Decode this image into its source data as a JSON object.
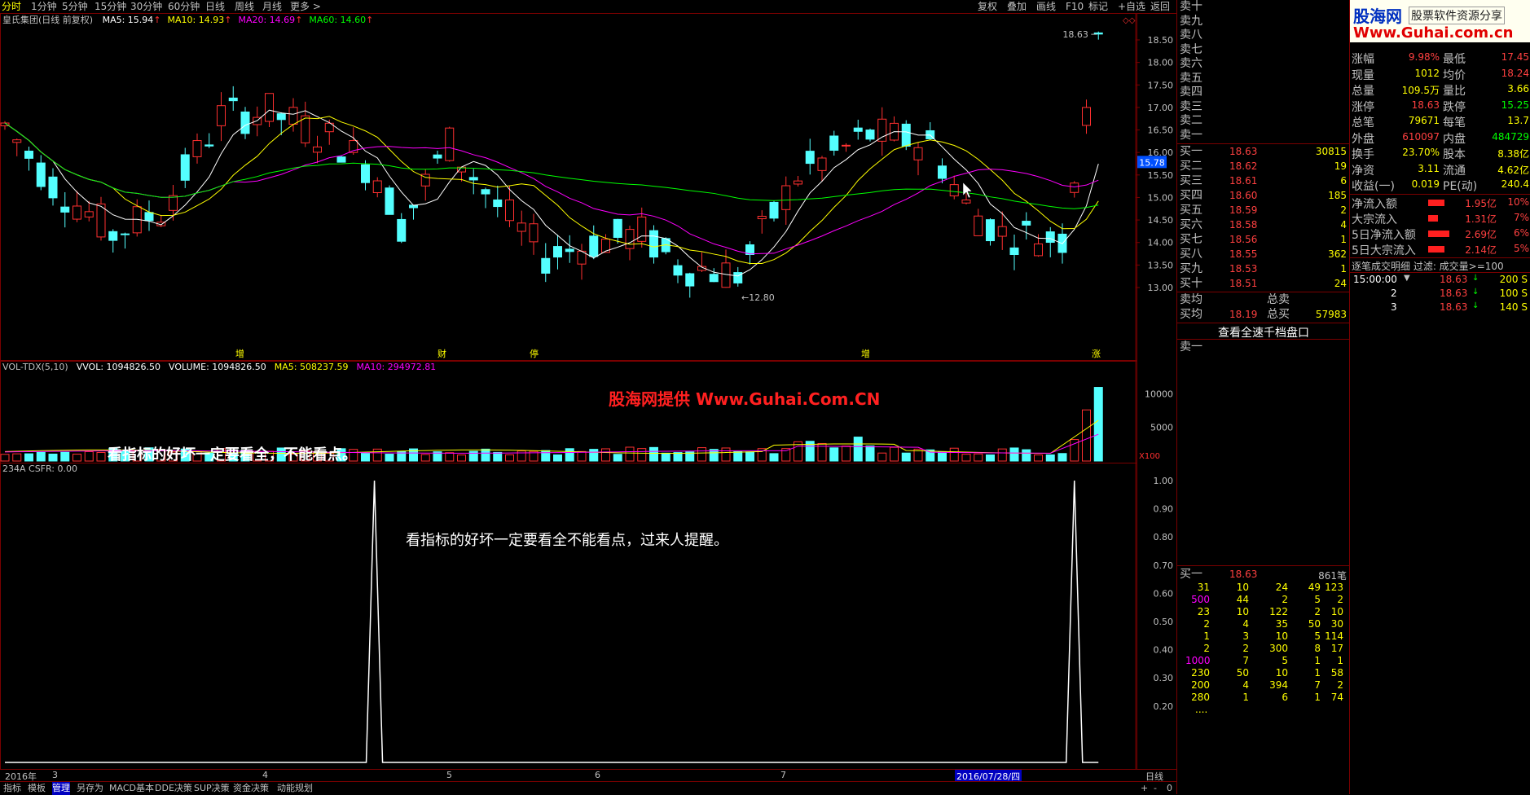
{
  "toolbar": {
    "periods": [
      "分时",
      "1分钟",
      "5分钟",
      "15分钟",
      "30分钟",
      "60分钟",
      "日线",
      "周线",
      "月线",
      "更多 >"
    ],
    "right_buttons": [
      "复权",
      "叠加",
      "画线",
      "F10",
      "标记",
      "+自选",
      "返回"
    ]
  },
  "main_chart": {
    "title": "皇氏集团(日线 前复权)",
    "ma_labels": [
      {
        "text": "MA5: 15.94",
        "color": "#ffffff"
      },
      {
        "text": "MA10: 14.93",
        "color": "#ffff00"
      },
      {
        "text": "MA20: 14.69",
        "color": "#ff00ff"
      },
      {
        "text": "MA60: 14.60",
        "color": "#00ff00"
      }
    ],
    "price_axis": [
      "18.50",
      "18.00",
      "17.50",
      "17.00",
      "16.50",
      "16.00",
      "15.50",
      "15.00",
      "14.50",
      "14.00",
      "13.50",
      "13.00"
    ],
    "current_price_tag": "15.78",
    "high_marker": "18.63",
    "low_marker": "12.80",
    "event_markers": [
      "增",
      "财",
      "停",
      "增",
      "涨"
    ]
  },
  "volume_chart": {
    "title_labels": [
      {
        "text": "VOL-TDX(5,10)",
        "color": "#c0c0c0"
      },
      {
        "text": "VVOL: 1094826.50",
        "color": "#ffffff"
      },
      {
        "text": "VOLUME: 1094826.50",
        "color": "#ffffff"
      },
      {
        "text": "MA5: 508237.59",
        "color": "#ffff00"
      },
      {
        "text": "MA10: 294972.81",
        "color": "#ff00ff"
      }
    ],
    "axis": [
      "10000",
      "5000"
    ],
    "multiplier": "X100",
    "watermark": "股海网提供 Www.Guhai.Com.CN",
    "annotation": "看指标的好坏一定要看全，不能看点。"
  },
  "indicator_chart": {
    "title": "234A  CSFR: 0.00",
    "axis": [
      "1.00",
      "0.90",
      "0.80",
      "0.70",
      "0.60",
      "0.50",
      "0.40",
      "0.30",
      "0.20"
    ],
    "annotation": "看指标的好坏一定要看全不能看点，过来人提醒。"
  },
  "date_axis": {
    "labels": [
      "2016年",
      "3",
      "4",
      "5",
      "6",
      "7"
    ],
    "highlight": "2016/07/28/四",
    "period": "日线"
  },
  "bottom_tabs": [
    "指标",
    "模板",
    "管理",
    "另存为",
    "MACD基本",
    "DDE决策",
    "SUP决策",
    "资金决策",
    "动能规划"
  ],
  "bottom_right": [
    "+",
    "-",
    "0"
  ],
  "order_book": {
    "sell_labels": [
      "卖十",
      "卖九",
      "卖八",
      "卖七",
      "卖六",
      "卖五",
      "卖四",
      "卖三",
      "卖二",
      "卖一"
    ],
    "buy_labels": [
      "买一",
      "买二",
      "买三",
      "买四",
      "买五",
      "买六",
      "买七",
      "买八",
      "买九",
      "买十"
    ],
    "buy_prices": [
      "18.63",
      "18.62",
      "18.61",
      "18.60",
      "18.59",
      "18.58",
      "18.56",
      "18.55",
      "18.53",
      "18.51"
    ],
    "buy_vols": [
      "30815",
      "19",
      "6",
      "185",
      "2",
      "4",
      "1",
      "362",
      "1",
      "24"
    ],
    "sell_avg_label": "卖均",
    "buy_avg_label": "买均",
    "buy_avg": "18.19",
    "total_sell_label": "总卖",
    "total_buy_label": "总买",
    "total_buy": "57983",
    "view_button": "查看全速千档盘口",
    "sell1_label": "卖一",
    "buy1_label": "买一",
    "buy1_price": "18.63",
    "buy1_count": "861笔",
    "queue_rows": [
      [
        "31",
        "10",
        "24",
        "49",
        "123"
      ],
      [
        "500",
        "44",
        "2",
        "5",
        "2"
      ],
      [
        "23",
        "10",
        "122",
        "2",
        "10"
      ],
      [
        "2",
        "4",
        "35",
        "50",
        "30"
      ],
      [
        "1",
        "3",
        "10",
        "5",
        "114"
      ],
      [
        "2",
        "2",
        "300",
        "8",
        "17"
      ],
      [
        "1000",
        "7",
        "5",
        "1",
        "1"
      ],
      [
        "230",
        "50",
        "10",
        "1",
        "58"
      ],
      [
        "200",
        "4",
        "394",
        "7",
        "2"
      ],
      [
        "280",
        "1",
        "6",
        "1",
        "74"
      ]
    ],
    "queue_more": "...."
  },
  "quote": {
    "logo_main": "股海网",
    "logo_slogan": "股票软件资源分享",
    "logo_url": "Www.Guhai.com.cn",
    "rows": [
      {
        "l1": "涨幅",
        "v1": "9.98%",
        "c1": "#ff4040",
        "l2": "最低",
        "v2": "17.45",
        "c2": "#ff4040"
      },
      {
        "l1": "现量",
        "v1": "1012",
        "c1": "#ffff00",
        "l2": "均价",
        "v2": "18.24",
        "c2": "#ff4040"
      },
      {
        "l1": "总量",
        "v1": "109.5万",
        "c1": "#ffff00",
        "l2": "量比",
        "v2": "3.66",
        "c2": "#ffff00"
      },
      {
        "l1": "涨停",
        "v1": "18.63",
        "c1": "#ff4040",
        "l2": "跌停",
        "v2": "15.25",
        "c2": "#00ff00"
      },
      {
        "l1": "总笔",
        "v1": "79671",
        "c1": "#ffff00",
        "l2": "每笔",
        "v2": "13.7",
        "c2": "#ffff00"
      },
      {
        "l1": "外盘",
        "v1": "610097",
        "c1": "#ff4040",
        "l2": "内盘",
        "v2": "484729",
        "c2": "#00ff00"
      },
      {
        "l1": "换手",
        "v1": "23.70%",
        "c1": "#ffff00",
        "l2": "股本",
        "v2": "8.38亿",
        "c2": "#ffff00"
      },
      {
        "l1": "净资",
        "v1": "3.11",
        "c1": "#ffff00",
        "l2": "流通",
        "v2": "4.62亿",
        "c2": "#ffff00"
      },
      {
        "l1": "收益(一)",
        "v1": "0.019",
        "c1": "#ffff00",
        "l2": "PE(动)",
        "v2": "240.4",
        "c2": "#ffff00"
      }
    ],
    "flows": [
      {
        "label": "净流入额",
        "val": "1.95亿",
        "pct": "10%"
      },
      {
        "label": "大宗流入",
        "val": "1.31亿",
        "pct": "7%"
      },
      {
        "label": "5日净流入额",
        "val": "2.69亿",
        "pct": "6%"
      },
      {
        "label": "5日大宗流入",
        "val": "2.14亿",
        "pct": "5%"
      }
    ],
    "trade_header": "逐笔成交明细 过滤: 成交量>=100",
    "trades": [
      {
        "t": "15:00:00",
        "mark": "▼",
        "p": "18.63",
        "v": "200 S"
      },
      {
        "t": "2",
        "mark": "",
        "p": "18.63",
        "v": "100 S"
      },
      {
        "t": "3",
        "mark": "",
        "p": "18.63",
        "v": "140 S"
      }
    ]
  },
  "colors": {
    "up": "#ff3030",
    "down": "#54ffff",
    "ma5": "#ffffff",
    "ma10": "#ffff00",
    "ma20": "#ff00ff",
    "ma60": "#00ff00",
    "border": "#7a0000"
  }
}
